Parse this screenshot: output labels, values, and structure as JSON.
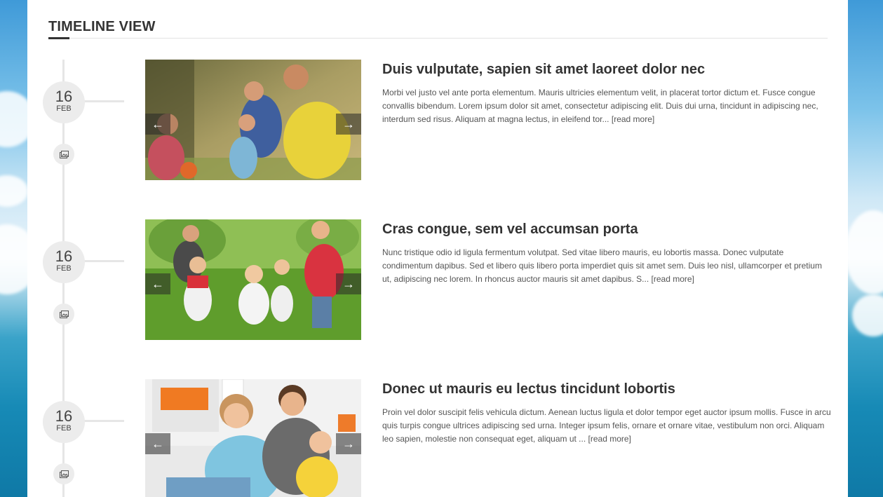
{
  "page": {
    "heading": "TIMELINE VIEW"
  },
  "colors": {
    "accent": "#333333",
    "timeline_line": "#e6e6e6",
    "date_circle": "#ececec",
    "text": "#555555"
  },
  "controls": {
    "prev_arrow": "←",
    "next_arrow": "→"
  },
  "posts": [
    {
      "day": "16",
      "month": "FEB",
      "media_icon": "gallery-icon",
      "image": "family-playing-ball-photo",
      "title": "Duis vulputate, sapien sit amet laoreet dolor nec",
      "excerpt": "Morbi vel justo vel ante porta elementum. Mauris ultricies elementum velit, in placerat tortor dictum et. Fusce congue convallis bibendum. Lorem ipsum dolor sit amet, consectetur adipiscing elit. Duis dui urna, tincidunt in adipiscing nec, interdum sed risus. Aliquam at magna lectus, in eleifend tor...",
      "read_more": "[read more]"
    },
    {
      "day": "16",
      "month": "FEB",
      "media_icon": "gallery-icon",
      "image": "family-running-in-field-photo",
      "title": "Cras congue, sem vel accumsan porta",
      "excerpt": "Nunc tristique odio id ligula fermentum volutpat. Sed vitae libero mauris, eu lobortis massa. Donec vulputate condimentum dapibus. Sed et libero quis libero porta imperdiet quis sit amet sem. Duis leo nisl, ullamcorper et pretium ut, adipiscing nec lorem. In rhoncus auctor mauris sit amet dapibus. S...",
      "read_more": "[read more]"
    },
    {
      "day": "16",
      "month": "FEB",
      "media_icon": "gallery-icon",
      "image": "family-on-sofa-photo",
      "title": "Donec ut mauris eu lectus tincidunt lobortis",
      "excerpt": "Proin vel dolor suscipit felis vehicula dictum. Aenean luctus ligula et dolor tempor eget auctor ipsum mollis. Fusce in arcu quis turpis congue ultrices adipiscing sed urna. Integer ipsum felis, ornare et ornare vitae, vestibulum non orci. Aliquam leo sapien, molestie non consequat eget, aliquam ut ...",
      "read_more": "[read more]"
    }
  ]
}
